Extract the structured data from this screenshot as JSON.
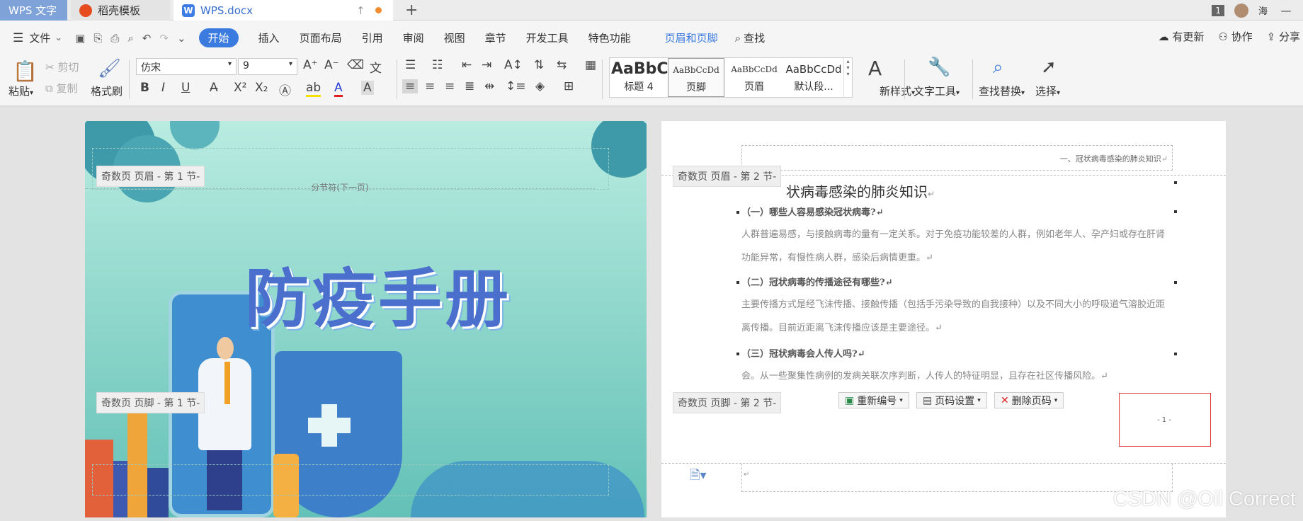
{
  "tabs": {
    "wps": "WPS 文字",
    "template": "稻壳模板",
    "doc": "WPS.docx"
  },
  "titlebar": {
    "badge": "1",
    "user": "海"
  },
  "menu": {
    "file": "文件",
    "items": [
      "开始",
      "插入",
      "页面布局",
      "引用",
      "审阅",
      "视图",
      "章节",
      "开发工具",
      "特色功能",
      "页眉和页脚",
      "查找"
    ],
    "right": [
      "有更新",
      "协作",
      "分享"
    ]
  },
  "ribbon": {
    "paste": "粘贴",
    "cut": "剪切",
    "copy": "复制",
    "format_painter": "格式刷",
    "font": "仿宋",
    "size": "9",
    "styles": [
      {
        "preview": "AaBbC",
        "name": "标题 4"
      },
      {
        "preview": "AaBbCcDd",
        "name": "页脚"
      },
      {
        "preview": "AaBbCcDd",
        "name": "页眉"
      },
      {
        "preview": "AaBbCcDd",
        "name": "默认段..."
      }
    ],
    "new_style": "新样式",
    "text_tools": "文字工具",
    "find_replace": "查找替换",
    "select": "选择"
  },
  "left_page": {
    "header_label": "奇数页 页眉  - 第 1 节-",
    "section_break": "分节符(下一页)",
    "cover_title": "防疫手册",
    "footer_label": "奇数页 页脚  - 第 1 节-"
  },
  "right_page": {
    "header_text": "一、冠状病毒感染的肺炎知识",
    "header_label": "奇数页 页眉  - 第 2 节-",
    "title": "状病毒感染的肺炎知识",
    "q1": "（一）哪些人容易感染冠状病毒?",
    "p1": "人群普遍易感，与接触病毒的量有一定关系。对于免疫功能较差的人群，例如老年人、孕产妇或存在肝肾功能异常，有慢性病人群，感染后病情更重。",
    "q2": "（二）冠状病毒的传播途径有哪些?",
    "p2": "主要传播方式是经飞沫传播、接触传播（包括手污染导致的自我接种）以及不同大小的呼吸道气溶胶近距离传播。目前近距离飞沫传播应该是主要途径。",
    "q3": "（三）冠状病毒会人传人吗?",
    "p3": "会。从一些聚集性病例的发病关联次序判断，人传人的特征明显，且存在社区传播风险。",
    "footer_label": "奇数页 页脚  - 第 2 节-",
    "btn_renumber": "重新编号",
    "btn_page_settings": "页码设置",
    "btn_delete_page_number": "删除页码",
    "page_number": "- 1 -"
  },
  "watermark": "CSDN @Oil Correct"
}
